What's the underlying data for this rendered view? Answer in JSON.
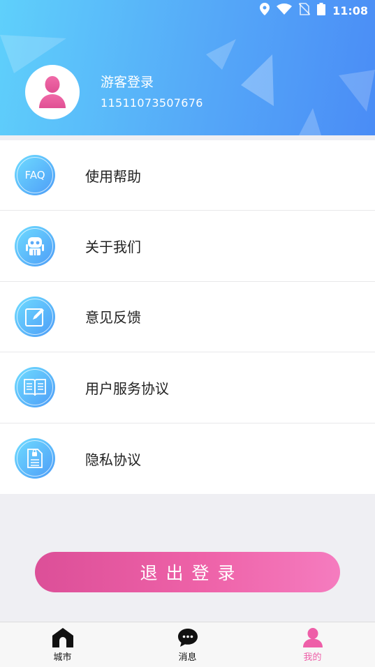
{
  "status_bar": {
    "time": "11:08",
    "icons": [
      "location-icon",
      "wifi-icon",
      "no-sim-icon",
      "battery-icon"
    ]
  },
  "profile": {
    "name": "游客登录",
    "id": "11511073507676",
    "avatar_icon": "user-icon"
  },
  "menu": {
    "items": [
      {
        "label": "使用帮助",
        "icon": "faq-icon"
      },
      {
        "label": "关于我们",
        "icon": "robot-icon"
      },
      {
        "label": "意见反馈",
        "icon": "edit-icon"
      },
      {
        "label": "用户服务协议",
        "icon": "book-icon"
      },
      {
        "label": "隐私协议",
        "icon": "document-lock-icon"
      }
    ]
  },
  "logout": {
    "label": "退出登录"
  },
  "tabbar": {
    "items": [
      {
        "label": "城市",
        "icon": "home-icon",
        "active": false
      },
      {
        "label": "消息",
        "icon": "chat-icon",
        "active": false
      },
      {
        "label": "我的",
        "icon": "profile-icon",
        "active": true
      }
    ]
  },
  "colors": {
    "header_start": "#5fd0fb",
    "header_end": "#4a8cf6",
    "accent_pink": "#ee5fa8",
    "icon_gradient_start": "#6fdcff",
    "icon_gradient_end": "#4d9cf7"
  }
}
